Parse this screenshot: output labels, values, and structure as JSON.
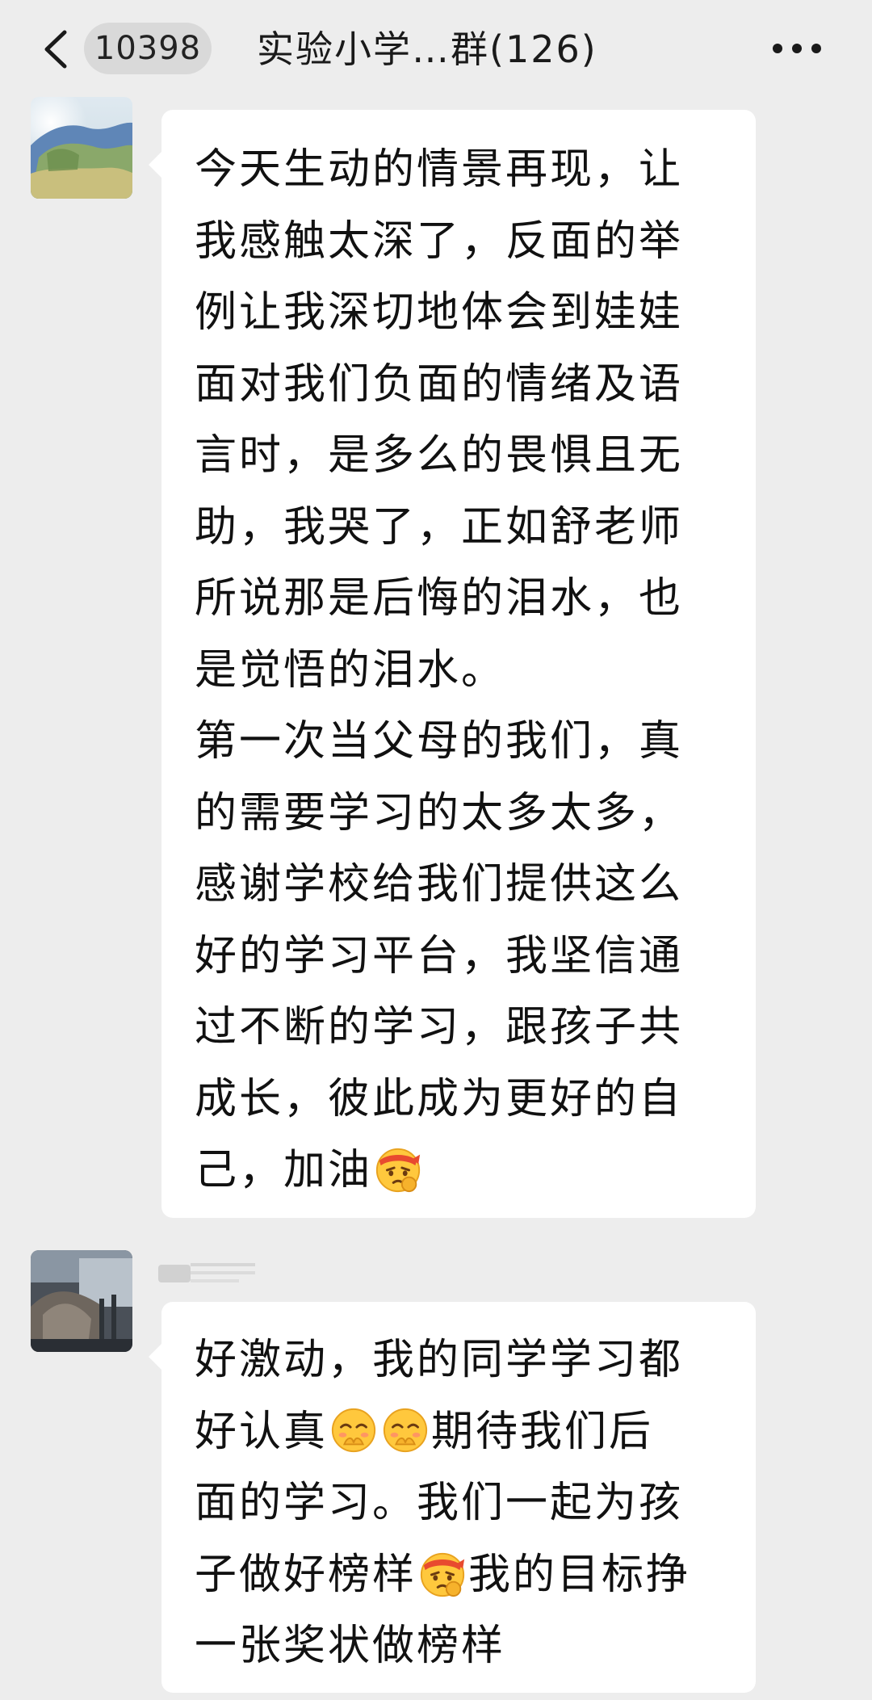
{
  "header": {
    "back_icon": "chevron-left-icon",
    "unread_count": "10398",
    "title": "实验小学…群(126)",
    "more_icon": "more-dots-icon"
  },
  "messages": [
    {
      "avatar_icon": "landscape-avatar",
      "text_lines": [
        "今天生动的情景再现，让",
        "我感触太深了，反面的举",
        "例让我深切地体会到娃娃",
        "面对我们负面的情绪及语",
        "言时，是多么的畏惧且无",
        "助，我哭了，正如舒老师",
        "所说那是后悔的泪水，也",
        "是觉悟的泪水。",
        "第一次当父母的我们，真",
        "的需要学习的太多太多，",
        "感谢学校给我们提供这么",
        "好的学习平台，我坚信通",
        "过不断的学习，跟孩子共",
        "成长，彼此成为更好的自"
      ],
      "last_line_text": "己，加油",
      "last_line_emoji": "determined-emoji"
    },
    {
      "avatar_icon": "photo-avatar",
      "text_lines": [
        "好激动，我的同学学习都"
      ],
      "line2_a": "好认真",
      "line2_emoji": "shy-giggle-emoji",
      "line2_b": "期待我们后",
      "line3": "面的学习。我们一起为孩",
      "line4_a": "子做好榜样",
      "line4_emoji": "determined-emoji",
      "line4_b": "我的目标挣",
      "line5": "一张奖状做榜样"
    }
  ],
  "colors": {
    "background": "#ededed",
    "bubble": "#ffffff",
    "text": "#111111",
    "badge": "#d9d9d9"
  }
}
